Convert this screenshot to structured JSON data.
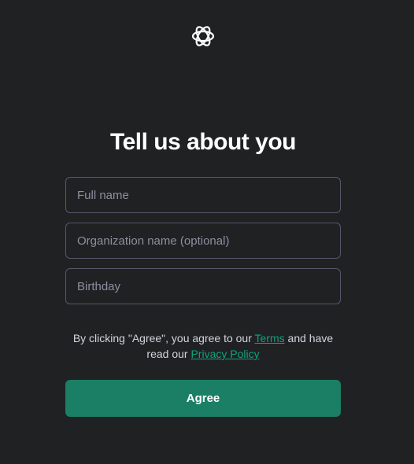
{
  "logo": {
    "icon": "openai-logo-icon"
  },
  "title": "Tell us about you",
  "form": {
    "full_name": {
      "placeholder": "Full name",
      "value": ""
    },
    "organization": {
      "placeholder": "Organization name (optional)",
      "value": ""
    },
    "birthday": {
      "placeholder": "Birthday",
      "value": ""
    }
  },
  "legal": {
    "text_1": "By clicking \"Agree\", you agree to our ",
    "terms_link": "Terms",
    "text_2": " and have read our ",
    "privacy_link": "Privacy Policy"
  },
  "agree_button": "Agree",
  "colors": {
    "background": "#202123",
    "accent": "#1a7f64",
    "link": "#10a37f",
    "field_border": "#565869"
  }
}
